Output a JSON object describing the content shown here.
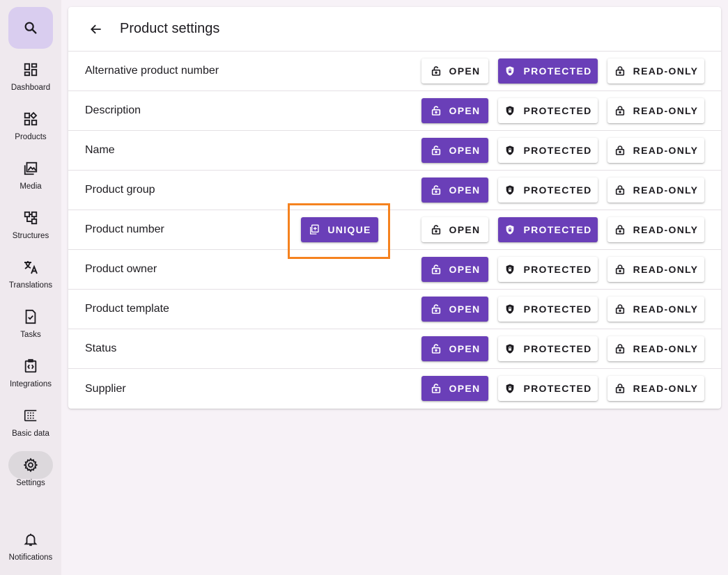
{
  "sidebar": {
    "search_icon": "search-icon",
    "items": [
      {
        "label": "Dashboard",
        "icon": "dashboard-icon"
      },
      {
        "label": "Products",
        "icon": "products-icon"
      },
      {
        "label": "Media",
        "icon": "media-icon"
      },
      {
        "label": "Structures",
        "icon": "structures-icon"
      },
      {
        "label": "Translations",
        "icon": "translate-icon"
      },
      {
        "label": "Tasks",
        "icon": "tasks-icon"
      },
      {
        "label": "Integrations",
        "icon": "integrations-icon"
      },
      {
        "label": "Basic data",
        "icon": "basic-data-icon"
      },
      {
        "label": "Settings",
        "icon": "gear-icon",
        "active": true
      }
    ],
    "notifications": {
      "label": "Notifications",
      "icon": "bell-icon"
    }
  },
  "header": {
    "title": "Product settings",
    "back_icon": "arrow-back-icon"
  },
  "buttons": {
    "open": "OPEN",
    "protected": "PROTECTED",
    "read_only": "READ-ONLY",
    "unique": "UNIQUE"
  },
  "rows": [
    {
      "label": "Alternative product number",
      "selected": "protected"
    },
    {
      "label": "Description",
      "selected": "open"
    },
    {
      "label": "Name",
      "selected": "open"
    },
    {
      "label": "Product group",
      "selected": "open"
    },
    {
      "label": "Product number",
      "selected": "protected",
      "unique": true
    },
    {
      "label": "Product owner",
      "selected": "open"
    },
    {
      "label": "Product template",
      "selected": "open"
    },
    {
      "label": "Status",
      "selected": "open"
    },
    {
      "label": "Supplier",
      "selected": "open"
    }
  ],
  "colors": {
    "accent": "#6a3fb8",
    "highlight": "#f5821f",
    "sidebar_bg": "#efe9ee",
    "search_bg": "#d9cdef"
  }
}
